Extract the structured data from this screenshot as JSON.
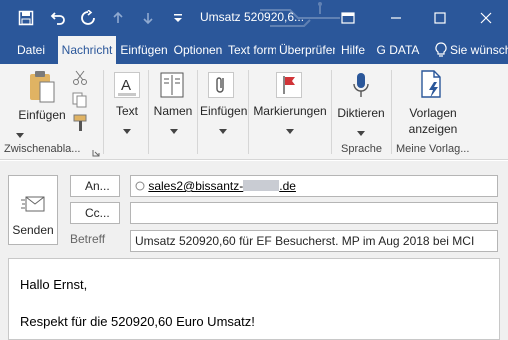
{
  "window": {
    "title": "Umsatz 520920,6...",
    "controls": [
      "restore-icon",
      "minimize-icon",
      "maximize-icon",
      "close-icon"
    ]
  },
  "quick_access": [
    "save-icon",
    "undo-icon",
    "redo-icon",
    "up-arrow-icon",
    "down-arrow-icon",
    "customize-icon"
  ],
  "tabs": [
    {
      "label": "Datei"
    },
    {
      "label": "Nachricht",
      "active": true
    },
    {
      "label": "Einfügen"
    },
    {
      "label": "Optionen"
    },
    {
      "label": "Text formatieren"
    },
    {
      "label": "Überprüfen"
    },
    {
      "label": "Hilfe"
    },
    {
      "label": "G DATA"
    },
    {
      "label": "Sie wünschen..."
    }
  ],
  "ribbon": {
    "paste_label": "Einfügen",
    "clipboard_group": "Zwischenabla...",
    "text_label": "Text",
    "names_label": "Namen",
    "insert_label": "Einfügen",
    "tags_label": "Markierungen",
    "dictate_label": "Diktieren",
    "voice_group": "Sprache",
    "templates_label_1": "Vorlagen",
    "templates_label_2": "anzeigen",
    "templates_group": "Meine Vorlag..."
  },
  "compose": {
    "send_label": "Senden",
    "to_button": "An...",
    "cc_button": "Cc...",
    "to_value_start": "sales2@bissantz-",
    "to_value_end": ".de",
    "cc_value": "",
    "subject_label": "Betreff",
    "subject_value": "Umsatz 520920,60 für EF Besucherst. MP im Aug 2018 bei MCI"
  },
  "body_lines": [
    "Hallo Ernst,",
    "Respekt für die 520920,60 Euro Umsatz!"
  ],
  "colors": {
    "brand": "#2b579a",
    "ribbon_bg": "#f3f3f3",
    "compose_bg": "#f0f0f0"
  }
}
